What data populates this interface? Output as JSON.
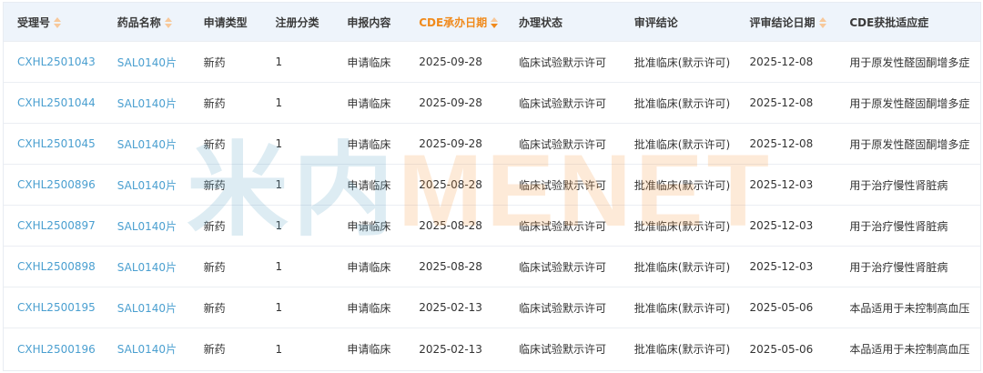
{
  "headers": [
    {
      "label": "受理号",
      "sortable": true,
      "active": false
    },
    {
      "label": "药品名称",
      "sortable": true,
      "active": false
    },
    {
      "label": "申请类型",
      "sortable": false,
      "active": false
    },
    {
      "label": "注册分类",
      "sortable": false,
      "active": false
    },
    {
      "label": "申报内容",
      "sortable": false,
      "active": false
    },
    {
      "label": "CDE承办日期",
      "sortable": true,
      "active": true
    },
    {
      "label": "办理状态",
      "sortable": false,
      "active": false
    },
    {
      "label": "审评结论",
      "sortable": false,
      "active": false
    },
    {
      "label": "评审结论日期",
      "sortable": true,
      "active": false
    },
    {
      "label": "CDE获批适应症",
      "sortable": false,
      "active": false
    }
  ],
  "rows": [
    [
      "CXHL2501043",
      "SAL0140片",
      "新药",
      "1",
      "申请临床",
      "2025-09-28",
      "临床试验默示许可",
      "批准临床(默示许可)",
      "2025-12-08",
      "用于原发性醛固酮增多症"
    ],
    [
      "CXHL2501044",
      "SAL0140片",
      "新药",
      "1",
      "申请临床",
      "2025-09-28",
      "临床试验默示许可",
      "批准临床(默示许可)",
      "2025-12-08",
      "用于原发性醛固酮增多症"
    ],
    [
      "CXHL2501045",
      "SAL0140片",
      "新药",
      "1",
      "申请临床",
      "2025-09-28",
      "临床试验默示许可",
      "批准临床(默示许可)",
      "2025-12-08",
      "用于原发性醛固酮增多症"
    ],
    [
      "CXHL2500896",
      "SAL0140片",
      "新药",
      "1",
      "申请临床",
      "2025-08-28",
      "临床试验默示许可",
      "批准临床(默示许可)",
      "2025-12-03",
      "用于治疗慢性肾脏病"
    ],
    [
      "CXHL2500897",
      "SAL0140片",
      "新药",
      "1",
      "申请临床",
      "2025-08-28",
      "临床试验默示许可",
      "批准临床(默示许可)",
      "2025-12-03",
      "用于治疗慢性肾脏病"
    ],
    [
      "CXHL2500898",
      "SAL0140片",
      "新药",
      "1",
      "申请临床",
      "2025-08-28",
      "临床试验默示许可",
      "批准临床(默示许可)",
      "2025-12-03",
      "用于治疗慢性肾脏病"
    ],
    [
      "CXHL2500195",
      "SAL0140片",
      "新药",
      "1",
      "申请临床",
      "2025-02-13",
      "临床试验默示许可",
      "批准临床(默示许可)",
      "2025-05-06",
      "本品适用于未控制高血压"
    ],
    [
      "CXHL2500196",
      "SAL0140片",
      "新药",
      "1",
      "申请临床",
      "2025-02-13",
      "临床试验默示许可",
      "批准临床(默示许可)",
      "2025-05-06",
      "本品适用于未控制高血压"
    ]
  ],
  "watermark": {
    "cn": "米内",
    "en": "MENET"
  }
}
